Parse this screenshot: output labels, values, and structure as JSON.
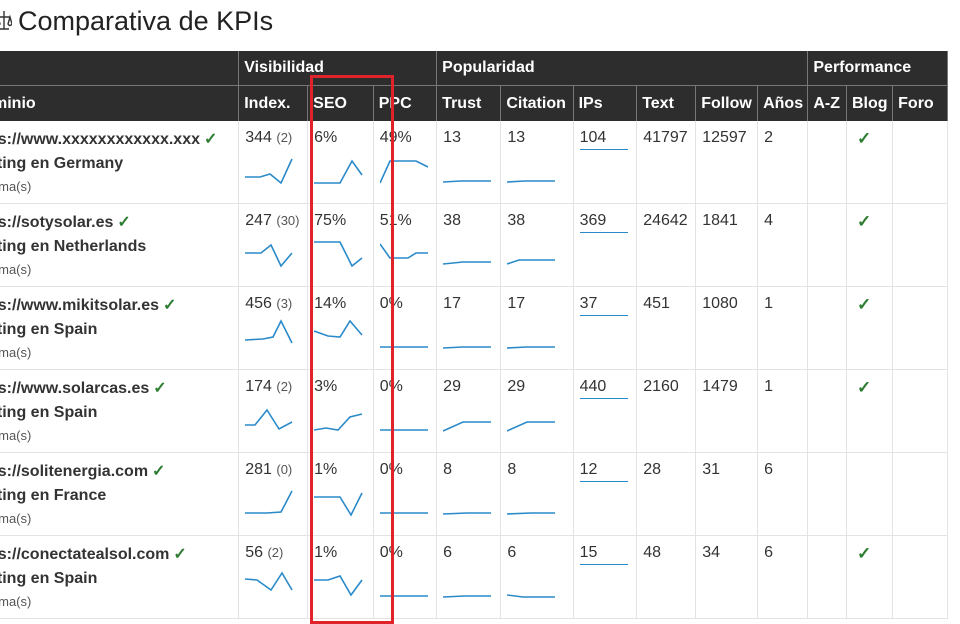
{
  "page": {
    "title": "Comparativa de KPIs",
    "title_icon": "scale-icon"
  },
  "header": {
    "groups": {
      "visibilidad": "Visibilidad",
      "popularidad": "Popularidad",
      "performance": "Performance"
    },
    "columns": [
      "minio",
      "Index.",
      "SEO",
      "PPC",
      "Trust",
      "Citation",
      "IPs",
      "Text",
      "Follow",
      "Años",
      "A-Z",
      "Blog",
      "Foro"
    ]
  },
  "colors": {
    "header_bg": "#2d2d2d",
    "spark": "#2a8ac9",
    "check": "#2e7d32",
    "highlight": "#e0232b"
  },
  "rows": [
    {
      "url": "ps://www.xxxxxxxxxxxx.xxx",
      "hosting": "sting en Germany",
      "lang": "ioma(s)",
      "index": "344",
      "index_sub": "(2)",
      "seo": "6%",
      "ppc": "49%",
      "trust": "13",
      "citation": "13",
      "ips": "104",
      "text": "41797",
      "follow": "12597",
      "anos": "2",
      "az": "",
      "blog": "✓",
      "foro": ""
    },
    {
      "url": "ps://sotysolar.es",
      "hosting": "sting en Netherlands",
      "lang": "ioma(s)",
      "index": "247",
      "index_sub": "(30)",
      "seo": "75%",
      "ppc": "51%",
      "trust": "38",
      "citation": "38",
      "ips": "369",
      "text": "24642",
      "follow": "1841",
      "anos": "4",
      "az": "",
      "blog": "✓",
      "foro": ""
    },
    {
      "url": "ps://www.mikitsolar.es",
      "hosting": "sting en Spain",
      "lang": "ioma(s)",
      "index": "456",
      "index_sub": "(3)",
      "seo": "14%",
      "ppc": "0%",
      "trust": "17",
      "citation": "17",
      "ips": "37",
      "text": "451",
      "follow": "1080",
      "anos": "1",
      "az": "",
      "blog": "✓",
      "foro": ""
    },
    {
      "url": "ps://www.solarcas.es",
      "hosting": "sting en Spain",
      "lang": "ioma(s)",
      "index": "174",
      "index_sub": "(2)",
      "seo": "3%",
      "ppc": "0%",
      "trust": "29",
      "citation": "29",
      "ips": "440",
      "text": "2160",
      "follow": "1479",
      "anos": "1",
      "az": "",
      "blog": "✓",
      "foro": ""
    },
    {
      "url": "ps://solitenergia.com",
      "hosting": "sting en France",
      "lang": "ioma(s)",
      "index": "281",
      "index_sub": "(0)",
      "seo": "1%",
      "ppc": "0%",
      "trust": "8",
      "citation": "8",
      "ips": "12",
      "text": "28",
      "follow": "31",
      "anos": "6",
      "az": "",
      "blog": "",
      "foro": ""
    },
    {
      "url": "ps://conectatealsol.com",
      "hosting": "sting en Spain",
      "lang": "ioma(s)",
      "index": "56",
      "index_sub": "(2)",
      "seo": "1%",
      "ppc": "0%",
      "trust": "6",
      "citation": "6",
      "ips": "15",
      "text": "48",
      "follow": "34",
      "anos": "6",
      "az": "",
      "blog": "✓",
      "foro": ""
    }
  ]
}
